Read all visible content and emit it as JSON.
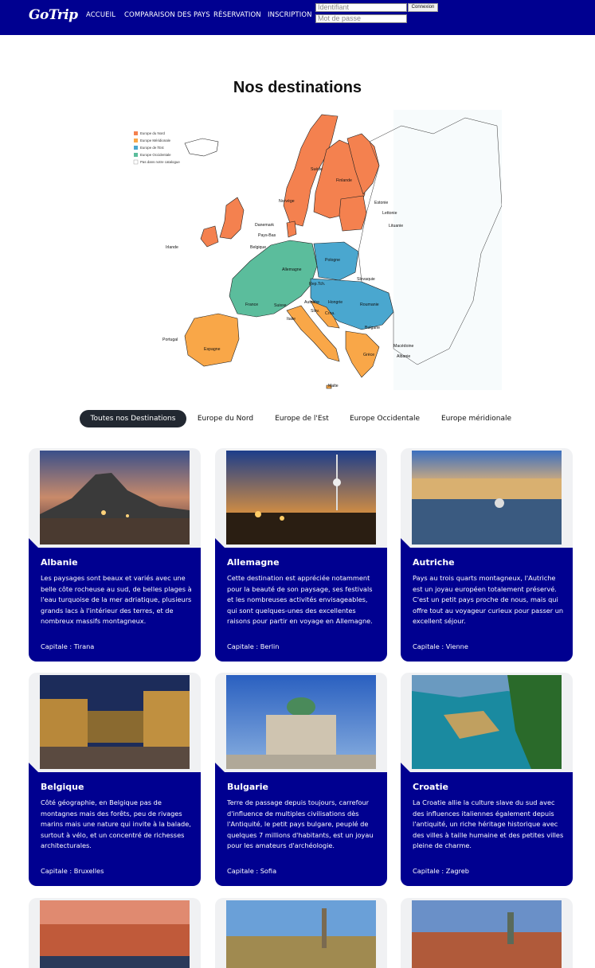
{
  "nav": {
    "logo": "GoTrip",
    "links": [
      "ACCUEIL",
      "COMPARAISON DES PAYS",
      "RÉSERVATION",
      "INSCRIPTION"
    ],
    "login": {
      "user_placeholder": "Identifiant",
      "pass_placeholder": "Mot de passe",
      "button": "Connexion"
    }
  },
  "title": "Nos destinations",
  "map": {
    "legend": [
      "Europe du Nord",
      "Europe Méridionale",
      "Europe de l'Est",
      "Europe Occidentale",
      "Pas dans notre catalogue"
    ],
    "legend_colors": [
      "#f4814f",
      "#f9a748",
      "#4aa7cf",
      "#5bbd9c",
      "#ffffff"
    ],
    "labels": [
      "Suède",
      "Finlande",
      "Norvège",
      "Estonie",
      "Lettonie",
      "Lituanie",
      "Danemark",
      "Pays-Bas",
      "Irlande",
      "Belgique",
      "Pologne",
      "Allemagne",
      "Rep.Tch.",
      "Slovaquie",
      "France",
      "Autriche",
      "Suisse",
      "Hongrie",
      "Roumanie",
      "Slov.",
      "Croa.",
      "Italie",
      "Bulgarie",
      "Portugal",
      "Espagne",
      "Macédoine",
      "Grèce",
      "Albanie",
      "Malte"
    ]
  },
  "filters": [
    "Toutes nos Destinations",
    "Europe du Nord",
    "Europe de l'Est",
    "Europe Occidentale",
    "Europe méridionale"
  ],
  "cards": [
    {
      "name": "Albanie",
      "desc": "Les paysages sont beaux et variés avec une belle côte rocheuse au sud, de belles plages à l'eau turquoise de la mer adriatique, plusieurs grands lacs à l'intérieur des terres, et de nombreux massifs montagneux.",
      "capital": "Capitale : Tirana"
    },
    {
      "name": "Allemagne",
      "desc": "Cette destination est appréciée notamment pour la beauté de son paysage, ses festivals et les nombreuses activités envisageables, qui sont quelques-unes des excellentes raisons pour partir en voyage en Allemagne.",
      "capital": "Capitale : Berlin"
    },
    {
      "name": "Autriche",
      "desc": "Pays au trois quarts montagneux, l'Autriche est un joyau européen totalement préservé. C'est un petit pays proche de nous, mais qui offre tout au voyageur curieux pour passer un excellent séjour.",
      "capital": "Capitale : Vienne"
    },
    {
      "name": "Belgique",
      "desc": "Côté géographie, en Belgique pas de montagnes mais des forêts, peu de rivages marins mais une nature qui invite à la balade, surtout à vélo, et un concentré de richesses architecturales.",
      "capital": "Capitale : Bruxelles"
    },
    {
      "name": "Bulgarie",
      "desc": "Terre de passage depuis toujours, carrefour d'influence de multiples civilisations dès l'Antiquité, le petit pays bulgare, peuplé de quelques 7 millions d'habitants, est un joyau pour les amateurs d'archéologie.",
      "capital": "Capitale : Sofia"
    },
    {
      "name": "Croatie",
      "desc": "La Croatie allie la culture slave du sud avec des influences italiennes également depuis l'antiquité, un riche héritage historique avec des villes à taille humaine et des petites villes pleine de charme.",
      "capital": "Capitale : Zagreb"
    }
  ],
  "colors": {
    "nav": "#000090",
    "card_body": "#000090",
    "active_filter": "#222831"
  }
}
